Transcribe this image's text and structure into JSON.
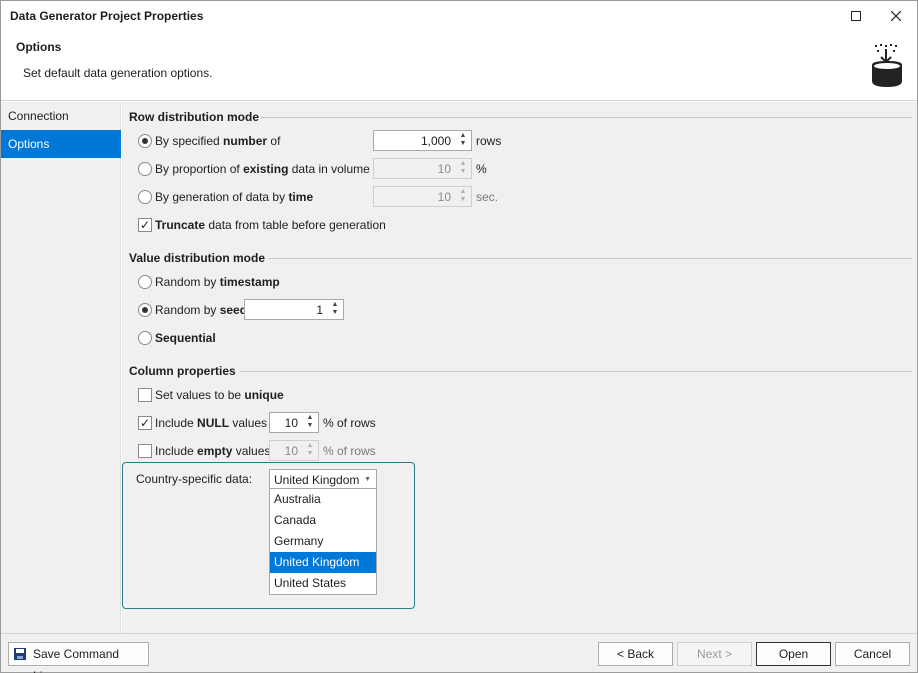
{
  "window": {
    "title": "Data Generator Project Properties",
    "maximize_glyph": "☐",
    "close_glyph": "✕"
  },
  "header": {
    "title": "Options",
    "description": "Set default data generation options.",
    "icon": "database-download-icon"
  },
  "sidebar": {
    "items": [
      {
        "label": "Connection",
        "selected": false
      },
      {
        "label": "Options",
        "selected": true
      }
    ]
  },
  "row_distribution": {
    "title": "Row distribution mode",
    "by_number": {
      "pre": "By specified ",
      "bold": "number",
      "post": " of",
      "value": "1,000",
      "unit": "rows",
      "checked": true
    },
    "by_proportion": {
      "pre": "By proportion of ",
      "bold": "existing",
      "post": " data in volume of",
      "value": "10",
      "unit": "%",
      "checked": false
    },
    "by_time": {
      "pre": "By generation of data by ",
      "bold": "time",
      "value": "10",
      "unit": "sec.",
      "checked": false
    },
    "truncate": {
      "bold": "Truncate",
      "post": " data from table before generation",
      "checked": true
    }
  },
  "value_distribution": {
    "title": "Value distribution mode",
    "random_timestamp": {
      "pre": "Random by ",
      "bold": "timestamp",
      "checked": false
    },
    "random_seed": {
      "pre": "Random by ",
      "bold": "seed",
      "value": "1",
      "checked": true
    },
    "sequential": {
      "bold": "Sequential",
      "checked": false
    }
  },
  "column_properties": {
    "title": "Column properties",
    "unique": {
      "pre": "Set values to be ",
      "bold": "unique",
      "checked": false
    },
    "include_null": {
      "pre": "Include ",
      "bold": "NULL",
      "post": " values",
      "value": "10",
      "unit": "% of rows",
      "checked": true
    },
    "include_empty": {
      "pre": "Include ",
      "bold": "empty",
      "post": " values",
      "value": "10",
      "unit": "% of rows",
      "checked": false
    }
  },
  "country": {
    "label": "Country-specific data:",
    "selected": "United Kingdom",
    "options": [
      "Australia",
      "Canada",
      "Germany",
      "United Kingdom",
      "United States"
    ]
  },
  "footer": {
    "save_label": "Save Command Line...",
    "back_label": "< Back",
    "next_label": "Next >",
    "open_label": "Open",
    "cancel_label": "Cancel"
  },
  "colors": {
    "accent": "#0078d7",
    "panel": "#f0f0f0",
    "focus_border": "#2a7c8b"
  }
}
